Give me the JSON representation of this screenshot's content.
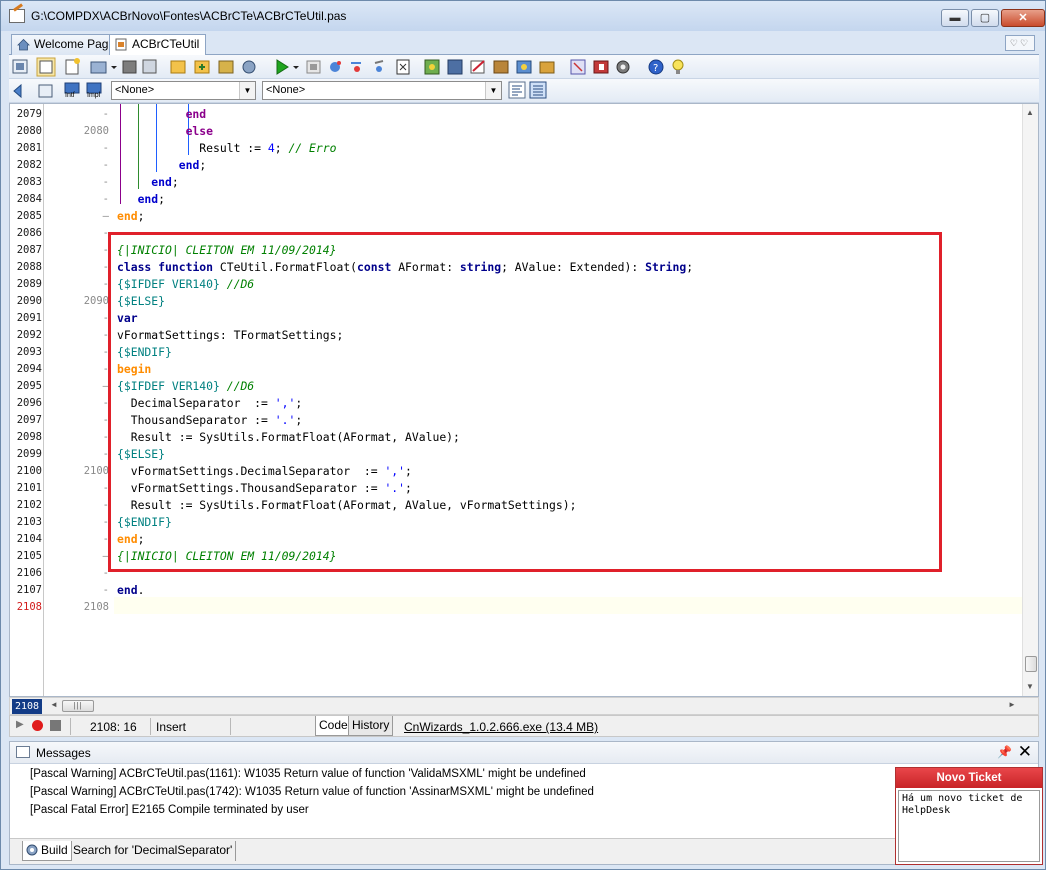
{
  "window": {
    "title": "G:\\COMPDX\\ACBrNovo\\Fontes\\ACBrCTe\\ACBrCTeUtil.pas",
    "minimize": "▬",
    "maximize": "▢",
    "close": "✕"
  },
  "tabs": [
    {
      "label": "Welcome Page",
      "active": false
    },
    {
      "label": "ACBrCTeUtil",
      "active": true
    }
  ],
  "tab_menu": "♡♡",
  "toolbar2": {
    "combo_left": "<None>",
    "combo_right": "<None>",
    "intf_label": "Intf",
    "impl_label": "Impl"
  },
  "editor": {
    "line_numbers": [
      "2079",
      "2080",
      "2081",
      "2082",
      "2083",
      "2084",
      "2085",
      "2086",
      "2087",
      "2088",
      "2089",
      "2090",
      "2091",
      "2092",
      "2093",
      "2094",
      "2095",
      "2096",
      "2097",
      "2098",
      "2099",
      "2100",
      "2101",
      "2102",
      "2103",
      "2104",
      "2105",
      "2106",
      "2107",
      "2108"
    ],
    "gutter_marks": [
      "-",
      "2080",
      "-",
      "-",
      "-",
      "-",
      "–",
      "-",
      "-",
      "-",
      "-",
      "2090",
      "-",
      "-",
      "-",
      "-",
      "–",
      "-",
      "-",
      "-",
      "-",
      "2100",
      "-",
      "-",
      "-",
      "-",
      "–",
      "-",
      "-",
      "2108"
    ],
    "current_line": "2108",
    "code_lines": [
      [
        {
          "t": "          "
        },
        {
          "t": "end",
          "c": "kw-p"
        }
      ],
      [
        {
          "t": "          "
        },
        {
          "t": "else",
          "c": "kw-p"
        }
      ],
      [
        {
          "t": "            Result := "
        },
        {
          "t": "4",
          "c": "num"
        },
        {
          "t": "; "
        },
        {
          "t": "// Erro",
          "c": "cmt"
        }
      ],
      [
        {
          "t": "         "
        },
        {
          "t": "end",
          "c": "kw-d"
        },
        {
          "t": ";"
        }
      ],
      [
        {
          "t": "     "
        },
        {
          "t": "end",
          "c": "kw-d"
        },
        {
          "t": ";"
        }
      ],
      [
        {
          "t": "   "
        },
        {
          "t": "end",
          "c": "kw-d"
        },
        {
          "t": ";"
        }
      ],
      [
        {
          "t": "end",
          "c": "kw-c"
        },
        {
          "t": ";"
        }
      ],
      [
        {
          "t": ""
        }
      ],
      [
        {
          "t": "{|INICIO| CLEITON EM 11/09/2014}",
          "c": "cmt"
        }
      ],
      [
        {
          "t": "class",
          "c": "kw"
        },
        {
          "t": " "
        },
        {
          "t": "function",
          "c": "kw"
        },
        {
          "t": " CTeUtil.FormatFloat("
        },
        {
          "t": "const",
          "c": "kw"
        },
        {
          "t": " AFormat: "
        },
        {
          "t": "string",
          "c": "kw"
        },
        {
          "t": "; AValue: Extended): "
        },
        {
          "t": "String",
          "c": "kw"
        },
        {
          "t": ";"
        }
      ],
      [
        {
          "t": "{$IFDEF VER140}",
          "c": "dir"
        },
        {
          "t": " "
        },
        {
          "t": "//D6",
          "c": "cmt"
        }
      ],
      [
        {
          "t": "{$ELSE}",
          "c": "dir"
        }
      ],
      [
        {
          "t": "var",
          "c": "kw"
        }
      ],
      [
        {
          "t": "vFormatSettings: TFormatSettings;"
        }
      ],
      [
        {
          "t": "{$ENDIF}",
          "c": "dir"
        }
      ],
      [
        {
          "t": "begin",
          "c": "kw-c"
        }
      ],
      [
        {
          "t": "{$IFDEF VER140}",
          "c": "dir"
        },
        {
          "t": " "
        },
        {
          "t": "//D6",
          "c": "cmt"
        }
      ],
      [
        {
          "t": "  DecimalSeparator  := "
        },
        {
          "t": "','",
          "c": "str"
        },
        {
          "t": ";"
        }
      ],
      [
        {
          "t": "  ThousandSeparator := "
        },
        {
          "t": "'.'",
          "c": "str"
        },
        {
          "t": ";"
        }
      ],
      [
        {
          "t": "  Result := SysUtils.FormatFloat(AFormat, AValue);"
        }
      ],
      [
        {
          "t": "{$ELSE}",
          "c": "dir"
        }
      ],
      [
        {
          "t": "  vFormatSettings.DecimalSeparator  := "
        },
        {
          "t": "','",
          "c": "str"
        },
        {
          "t": ";"
        }
      ],
      [
        {
          "t": "  vFormatSettings.ThousandSeparator := "
        },
        {
          "t": "'.'",
          "c": "str"
        },
        {
          "t": ";"
        }
      ],
      [
        {
          "t": "  Result := SysUtils.FormatFloat(AFormat, AValue, vFormatSettings);"
        }
      ],
      [
        {
          "t": "{$ENDIF}",
          "c": "dir"
        }
      ],
      [
        {
          "t": "end",
          "c": "kw-c"
        },
        {
          "t": ";"
        }
      ],
      [
        {
          "t": "{|INICIO| CLEITON EM 11/09/2014}",
          "c": "cmt"
        }
      ],
      [
        {
          "t": ""
        }
      ],
      [
        {
          "t": "end",
          "c": "kw"
        },
        {
          "t": "."
        }
      ],
      [
        {
          "t": ""
        }
      ]
    ]
  },
  "hscroll": {
    "line_badge": "2108",
    "thumb_grip": "|||"
  },
  "statusbar": {
    "position": "2108:  16",
    "mode": "Insert",
    "tab_code": "Code",
    "tab_history": "History",
    "wizard_link": "CnWizards_1.0.2.666.exe (13.4 MB)"
  },
  "messages": {
    "title": "Messages",
    "pin": "📌",
    "close": "✕",
    "items": [
      "[Pascal Warning] ACBrCTeUtil.pas(1161): W1035 Return value of function 'ValidaMSXML' might be undefined",
      "[Pascal Warning] ACBrCTeUtil.pas(1742): W1035 Return value of function 'AssinarMSXML' might be undefined",
      "[Pascal Fatal Error] E2165 Compile terminated by user"
    ],
    "bottom_tabs": [
      "Build",
      "Search for 'DecimalSeparator'"
    ]
  },
  "ticket": {
    "title": "Novo Ticket",
    "body": "Há um novo ticket de HelpDesk"
  },
  "colors": {
    "highlight_box": "#e0202a",
    "ticket_header": "#c82427",
    "line_badge": "#123b86"
  }
}
